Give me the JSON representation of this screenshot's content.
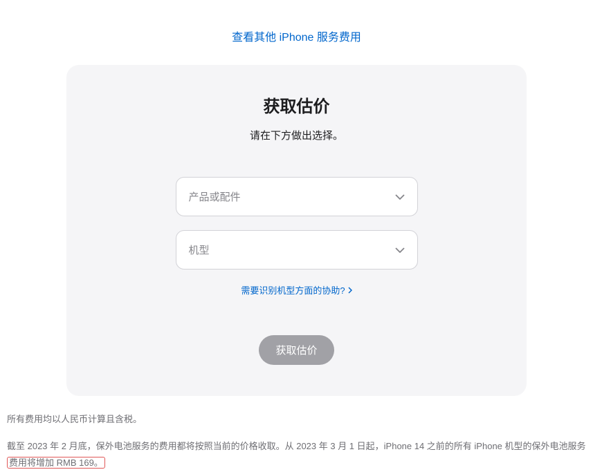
{
  "top_link": {
    "label": "查看其他 iPhone 服务费用"
  },
  "card": {
    "title": "获取估价",
    "subtitle": "请在下方做出选择。",
    "select_product": "产品或配件",
    "select_model": "机型",
    "help_link": "需要识别机型方面的协助?",
    "submit_label": "获取估价"
  },
  "footer": {
    "line1": "所有费用均以人民币计算且含税。",
    "line2_part1": "截至 2023 年 2 月底，保外电池服务的费用都将按照当前的价格收取。从 2023 年 3 月 1 日起，iPhone 14 之前的所有 iPhone 机型的保外电池服务",
    "line2_highlight": "费用将增加 RMB 169。"
  }
}
